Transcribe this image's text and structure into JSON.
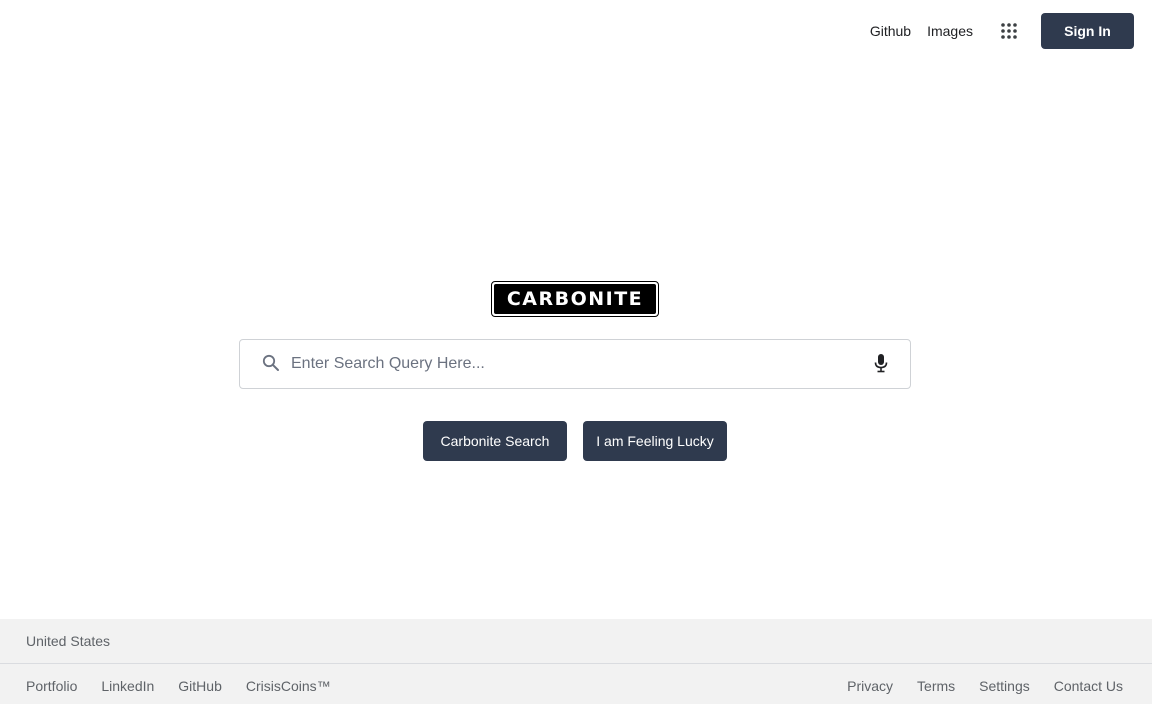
{
  "header": {
    "links": [
      "Github",
      "Images"
    ],
    "apps_icon": "grid-dots-icon",
    "sign_in_label": "Sign In"
  },
  "logo": {
    "text": "CARBONITE"
  },
  "search": {
    "value": "",
    "placeholder": "Enter Search Query Here...",
    "search_icon": "search-icon",
    "mic_icon": "microphone-icon"
  },
  "buttons": {
    "search_label": "Carbonite Search",
    "lucky_label": "I am Feeling Lucky"
  },
  "footer": {
    "country": "United States",
    "left_links": [
      "Portfolio",
      "LinkedIn",
      "GitHub",
      "CrisisCoins™"
    ],
    "right_links": [
      "Privacy",
      "Terms",
      "Settings",
      "Contact Us"
    ]
  },
  "colors": {
    "button_bg": "#2f3a4e",
    "footer_bg": "#f2f2f2",
    "footer_text": "#5f6368"
  }
}
